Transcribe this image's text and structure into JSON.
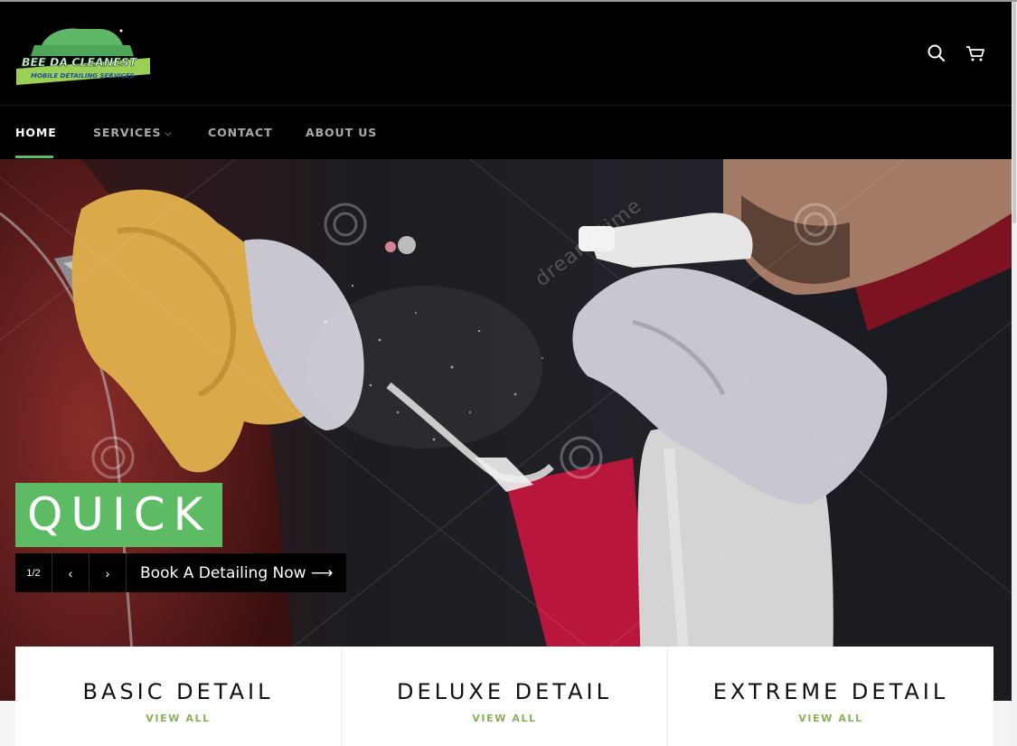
{
  "brand": {
    "logo_title": "BEE DA CLEANEST",
    "logo_subtitle": "MOBILE DETAILING SERVICES",
    "accent_color": "#5dbb63",
    "link_color": "#86b35a"
  },
  "header": {
    "search_icon": "search-icon",
    "cart_icon": "cart-icon"
  },
  "nav": {
    "items": [
      {
        "label": "HOME",
        "active": true
      },
      {
        "label": "SERVICES",
        "has_dropdown": true
      },
      {
        "label": "CONTACT"
      },
      {
        "label": "ABOUT US"
      }
    ]
  },
  "hero": {
    "title": "QUICK",
    "counter": "1/2",
    "prev_icon": "chevron-left-icon",
    "next_icon": "chevron-right-icon",
    "cta_label": "Book A Detailing Now ⟶",
    "watermark": "dreamstime"
  },
  "collections": [
    {
      "title": "BASIC DETAIL",
      "link": "VIEW ALL"
    },
    {
      "title": "DELUXE DETAIL",
      "link": "VIEW ALL"
    },
    {
      "title": "EXTREME DETAIL",
      "link": "VIEW ALL"
    }
  ]
}
